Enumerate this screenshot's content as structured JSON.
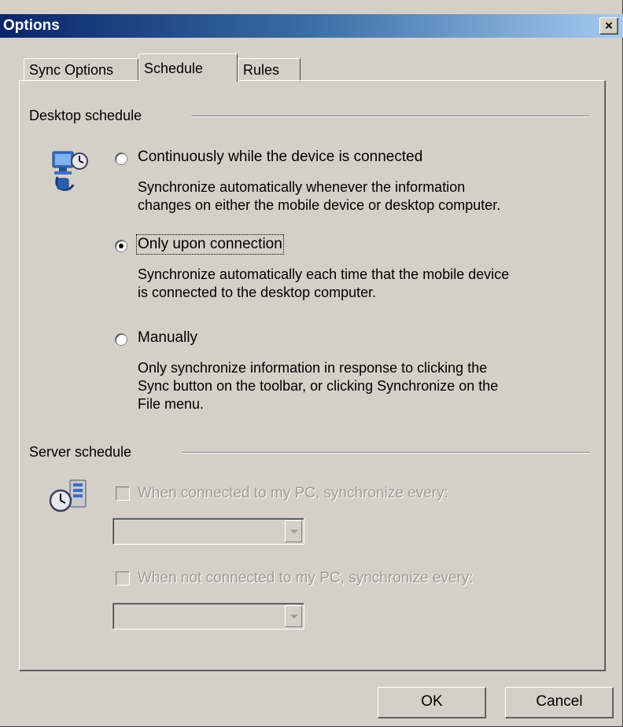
{
  "window": {
    "title": "Options",
    "close_label": "×"
  },
  "tabs": [
    {
      "label": "Sync Options",
      "active": false
    },
    {
      "label": "Schedule",
      "active": true
    },
    {
      "label": "Rules",
      "active": false
    }
  ],
  "desktop_schedule": {
    "group_label": "Desktop schedule",
    "icon": "desktop-sync-icon",
    "options": [
      {
        "label": "Continuously while the device is connected",
        "selected": false,
        "description_lines": [
          "Synchronize automatically whenever the information",
          "changes on either the mobile device or desktop computer."
        ]
      },
      {
        "label": "Only upon connection",
        "selected": true,
        "description_lines": [
          "Synchronize automatically each time that the mobile device",
          "is connected to the desktop computer."
        ]
      },
      {
        "label": "Manually",
        "selected": false,
        "description_lines": [
          "Only synchronize information in response to clicking the",
          "Sync button on the toolbar, or clicking Synchronize on the",
          "File menu."
        ]
      }
    ]
  },
  "server_schedule": {
    "group_label": "Server schedule",
    "icon": "server-sync-icon",
    "connected_label": "When connected to my PC, synchronize every:",
    "connected_value": "",
    "not_connected_label": "When not connected to my PC, synchronize every:",
    "not_connected_value": "",
    "enabled": false
  },
  "buttons": {
    "ok": "OK",
    "cancel": "Cancel"
  },
  "colors": {
    "face": "#d4d0c8",
    "title_start": "#0a246a",
    "title_end": "#a6caf0",
    "disabled_text": "#a09c94"
  }
}
